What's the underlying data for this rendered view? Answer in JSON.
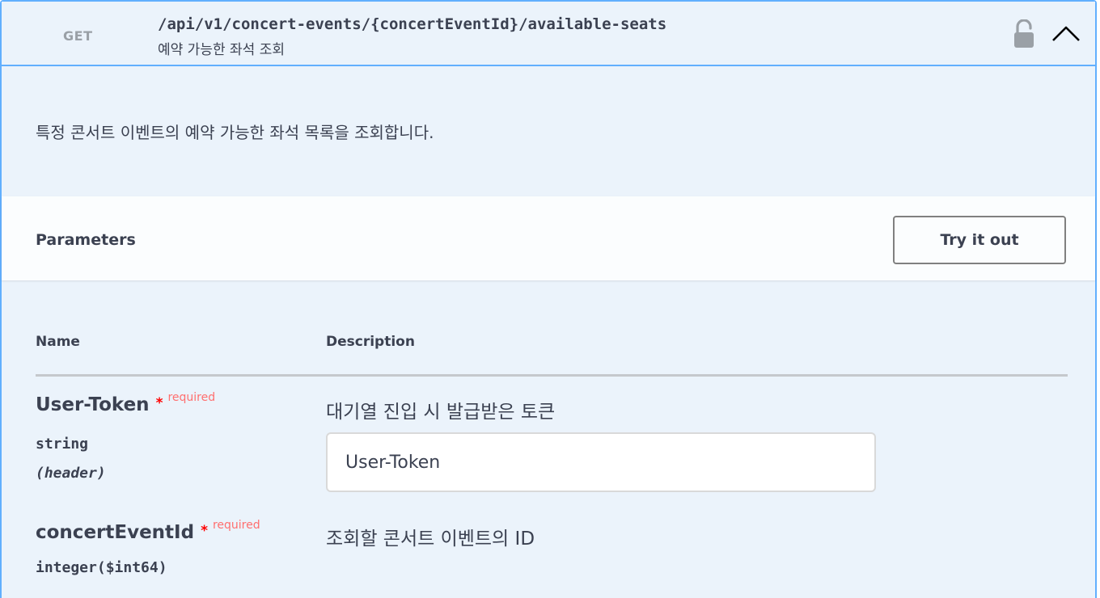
{
  "operation": {
    "method": "GET",
    "path": "/api/v1/concert-events/{concertEventId}/available-seats",
    "summary": "예약 가능한 좌석 조회",
    "description": "특정 콘서트 이벤트의 예약 가능한 좌석 목록을 조회합니다.",
    "icons": {
      "lock": "unlocked-padlock-icon",
      "toggle": "chevron-up-icon"
    }
  },
  "parameters": {
    "title": "Parameters",
    "try_label": "Try it out",
    "columns": {
      "name": "Name",
      "description": "Description"
    },
    "items": [
      {
        "name": "User-Token",
        "required_star": "*",
        "required_label": "required",
        "type": "string",
        "in": "(header)",
        "description": "대기열 진입 시 발급받은 토큰",
        "placeholder": "User-Token"
      },
      {
        "name": "concertEventId",
        "required_star": "*",
        "required_label": "required",
        "type": "integer($int64)",
        "description": "조회할 콘서트 이벤트의 ID"
      }
    ]
  },
  "colors": {
    "accent": "#61affe",
    "background": "#ebf3fb",
    "required": "#ff0000",
    "text": "#3b4151"
  }
}
